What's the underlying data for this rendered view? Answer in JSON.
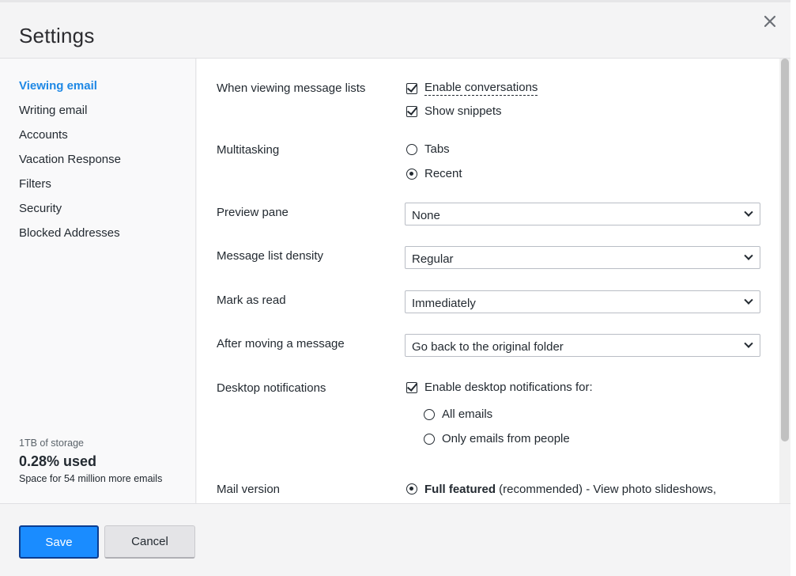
{
  "dialog": {
    "title": "Settings"
  },
  "sidebar": {
    "items": [
      {
        "label": "Viewing email",
        "active": true
      },
      {
        "label": "Writing email"
      },
      {
        "label": "Accounts"
      },
      {
        "label": "Vacation Response"
      },
      {
        "label": "Filters"
      },
      {
        "label": "Security"
      },
      {
        "label": "Blocked Addresses"
      }
    ],
    "storage": {
      "capacity": "1TB of storage",
      "used": "0.28% used",
      "remaining": "Space for 54 million more emails"
    }
  },
  "settings": {
    "message_lists": {
      "label": "When viewing message lists",
      "enable_conversations": "Enable conversations",
      "show_snippets": "Show snippets"
    },
    "multitasking": {
      "label": "Multitasking",
      "tabs": "Tabs",
      "recent": "Recent",
      "selected": "Recent"
    },
    "preview_pane": {
      "label": "Preview pane",
      "value": "None"
    },
    "density": {
      "label": "Message list density",
      "value": "Regular"
    },
    "mark_as_read": {
      "label": "Mark as read",
      "value": "Immediately"
    },
    "after_moving": {
      "label": "After moving a message",
      "value": "Go back to the original folder"
    },
    "desktop_notifications": {
      "label": "Desktop notifications",
      "enable": "Enable desktop notifications for:",
      "all_emails": "All emails",
      "only_people": "Only emails from people"
    },
    "mail_version": {
      "label": "Mail version",
      "option_bold": "Full featured",
      "option_rest": " (recommended) - View photo slideshows,"
    }
  },
  "footer": {
    "save_label": "Save",
    "cancel_label": "Cancel"
  },
  "colors": {
    "accent": "#1e88e5",
    "save_button": "#1a8cff"
  }
}
